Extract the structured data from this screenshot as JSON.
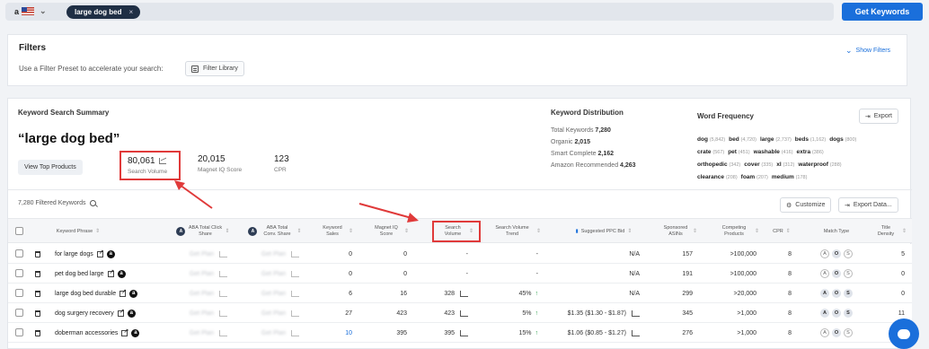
{
  "topbar": {
    "marketplace": "a",
    "keyword_chip": "large dog bed",
    "chip_close": "×",
    "get_keywords": "Get Keywords"
  },
  "filters": {
    "title": "Filters",
    "subtitle": "Use a Filter Preset to accelerate your search:",
    "filter_library": "Filter Library",
    "show_filters": "Show Filters"
  },
  "summary": {
    "title": "Keyword Search Summary",
    "keyword": "“large dog bed”",
    "view_top_products": "View Top Products",
    "metrics": [
      {
        "value": "80,061",
        "label": "Search Volume"
      },
      {
        "value": "20,015",
        "label": "Magnet IQ Score"
      },
      {
        "value": "123",
        "label": "CPR"
      }
    ]
  },
  "distribution": {
    "title": "Keyword Distribution",
    "rows": [
      {
        "label": "Total Keywords",
        "value": "7,280"
      },
      {
        "label": "Organic",
        "value": "2,015"
      },
      {
        "label": "Smart Complete",
        "value": "2,162"
      },
      {
        "label": "Amazon Recommended",
        "value": "4,263"
      }
    ]
  },
  "word_frequency": {
    "title": "Word Frequency",
    "export": "Export",
    "words": [
      {
        "w": "dog",
        "n": "(5,842)"
      },
      {
        "w": "bed",
        "n": "(4,720)"
      },
      {
        "w": "large",
        "n": "(2,737)"
      },
      {
        "w": "beds",
        "n": "(1,162)"
      },
      {
        "w": "dogs",
        "n": "(800)"
      },
      {
        "w": "crate",
        "n": "(567)"
      },
      {
        "w": "pet",
        "n": "(451)"
      },
      {
        "w": "washable",
        "n": "(416)"
      },
      {
        "w": "extra",
        "n": "(386)"
      },
      {
        "w": "orthopedic",
        "n": "(342)"
      },
      {
        "w": "cover",
        "n": "(335)"
      },
      {
        "w": "xl",
        "n": "(312)"
      },
      {
        "w": "waterproof",
        "n": "(288)"
      },
      {
        "w": "clearance",
        "n": "(208)"
      },
      {
        "w": "foam",
        "n": "(207)"
      },
      {
        "w": "medium",
        "n": "(178)"
      }
    ]
  },
  "toolbar": {
    "filtered_count": "7,280 Filtered Keywords",
    "customize": "Customize",
    "export_data": "Export Data..."
  },
  "table": {
    "headers": {
      "phrase": "Keyword Phrase",
      "aba_click": "ABA Total Click Share",
      "aba_conv": "ABA Total Conv. Share",
      "sales": "Keyword Sales",
      "miq": "Magnet IQ Score",
      "sv": "Search Volume",
      "svt": "Search Volume Trend",
      "ppc": "Suggested PPC Bid",
      "sponsored": "Sponsored ASINs",
      "competing": "Competing Products",
      "cpr": "CPR",
      "match": "Match Type",
      "title_density": "Title Density"
    },
    "rows": [
      {
        "phrase": "for large dogs",
        "aba1": "Get Plan",
        "aba2": "Get Plan",
        "sales": "0",
        "miq": "0",
        "sv": "-",
        "svt": "-",
        "ppc": "N/A",
        "sponsored": "157",
        "competing": ">100,000",
        "cpr": "8",
        "td": "5"
      },
      {
        "phrase": "pet dog bed large",
        "aba1": "Get Plan",
        "aba2": "Get Plan",
        "sales": "0",
        "miq": "0",
        "sv": "-",
        "svt": "-",
        "ppc": "N/A",
        "sponsored": "191",
        "competing": ">100,000",
        "cpr": "8",
        "td": "0"
      },
      {
        "phrase": "large dog bed durable",
        "aba1": "Get Plan",
        "aba2": "Get Plan",
        "sales": "6",
        "miq": "16",
        "sv": "328",
        "svt": "45%",
        "ppc": "N/A",
        "sponsored": "299",
        "competing": ">20,000",
        "cpr": "8",
        "td": "0"
      },
      {
        "phrase": "dog surgery recovery",
        "aba1": "Get Plan",
        "aba2": "Get Plan",
        "sales": "27",
        "miq": "423",
        "sv": "423",
        "svt": "5%",
        "ppc": "$1.35 ($1.30 - $1.87)",
        "sponsored": "345",
        "competing": ">1,000",
        "cpr": "8",
        "td": "11"
      },
      {
        "phrase": "doberman accessories",
        "aba1": "Get Plan",
        "aba2": "Get Plan",
        "sales": "10",
        "miq": "395",
        "sv": "395",
        "svt": "15%",
        "ppc": "$1.06 ($0.85 - $1.27)",
        "sponsored": "276",
        "competing": ">1,000",
        "cpr": "8",
        "td": "0"
      }
    ]
  },
  "colors": {
    "accent": "#1a6fdb",
    "annotation": "#e03a3a",
    "chip": "#1f2f45"
  }
}
